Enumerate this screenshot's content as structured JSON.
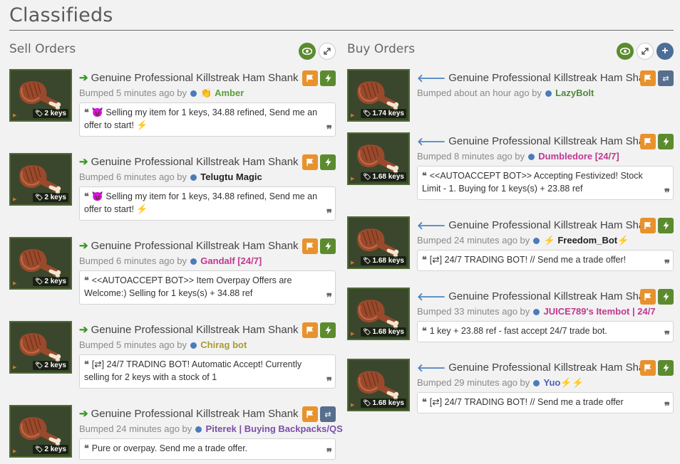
{
  "page": {
    "title": "Classifieds"
  },
  "colors": {
    "sell_arrow": "#3d9a2a",
    "buy_arrow": "#4d84c4",
    "orange_btn": "#e8922e",
    "green_btn": "#5b8b2e",
    "blue_btn": "#576e8c",
    "user_dot": "#4a7cba"
  },
  "sell": {
    "title": "Sell Orders",
    "listings": [
      {
        "item": "Genuine Professional Killstreak Ham Shank",
        "price": "2 keys",
        "bumped": "Bumped 5 minutes ago by",
        "user_prefix_icon": "👏",
        "user": "Amber",
        "user_color": "#5a9e3a",
        "user_suffix_icon": "",
        "message_icon": "😈",
        "message": "Selling my item for 1 keys, 34.88 refined, Send me an offer to start! ",
        "message_suffix": "⚡",
        "action_icon": "lightning"
      },
      {
        "item": "Genuine Professional Killstreak Ham Shank",
        "price": "2 keys",
        "bumped": "Bumped 6 minutes ago by",
        "user_prefix_icon": "",
        "user": "Telugtu Magic",
        "user_color": "#222222",
        "user_suffix_icon": "",
        "message_icon": "😈",
        "message": "Selling my item for 1 keys, 34.88 refined, Send me an offer to start! ",
        "message_suffix": "⚡",
        "action_icon": "lightning"
      },
      {
        "item": "Genuine Professional Killstreak Ham Shank",
        "price": "2 keys",
        "bumped": "Bumped 6 minutes ago by",
        "user_prefix_icon": "",
        "user": "Gandalf [24/7]",
        "user_color": "#c0388f",
        "user_suffix_icon": "",
        "message_icon": "",
        "message": "<<AUTOACCEPT BOT>> Item Overpay Offers are Welcome:) Selling for 1 keys(s) + 34.88 ref",
        "message_suffix": "",
        "action_icon": "lightning"
      },
      {
        "item": "Genuine Professional Killstreak Ham Shank",
        "price": "2 keys",
        "bumped": "Bumped 5 minutes ago by",
        "user_prefix_icon": "",
        "user": "Chirag bot",
        "user_color": "#a89b2f",
        "user_suffix_icon": "",
        "message_icon": "",
        "message": "[⇄] 24/7 TRADING BOT! Automatic Accept! Currently selling for 2 keys with a stock of 1",
        "message_suffix": "",
        "action_icon": "lightning"
      },
      {
        "item": "Genuine Professional Killstreak Ham Shank",
        "price": "2 keys",
        "bumped": "Bumped 24 minutes ago by",
        "user_prefix_icon": "",
        "user": "Piterek | Buying Backpacks/QS",
        "user_color": "#7b4fa8",
        "user_suffix_icon": "",
        "message_icon": "",
        "message": "Pure or overpay. Send me a trade offer.",
        "message_suffix": "",
        "action_icon": "swap"
      }
    ]
  },
  "buy": {
    "title": "Buy Orders",
    "listings": [
      {
        "item": "Genuine Professional Killstreak Ham Shank",
        "price": "1.74 keys",
        "bumped": "Bumped about an hour ago by",
        "user_prefix_icon": "",
        "user": "LazyBolt",
        "user_color": "#4f8a3a",
        "user_suffix_icon": "",
        "message_icon": "",
        "message": "",
        "message_suffix": "",
        "action_icon": "swap"
      },
      {
        "item": "Genuine Professional Killstreak Ham Shank",
        "price": "1.68 keys",
        "bumped": "Bumped 8 minutes ago by",
        "user_prefix_icon": "",
        "user": "Dumbledore [24/7]",
        "user_color": "#c0388f",
        "user_suffix_icon": "",
        "message_icon": "",
        "message": "<<AUTOACCEPT BOT>> Accepting Festivized! Stock Limit - 1. Buying for 1 keys(s) + 23.88 ref",
        "message_suffix": "",
        "action_icon": "lightning"
      },
      {
        "item": "Genuine Professional Killstreak Ham Shank",
        "price": "1.68 keys",
        "bumped": "Bumped 24 minutes ago by",
        "user_prefix_icon": "⚡",
        "user": "Freedom_Bot",
        "user_color": "#222222",
        "user_suffix_icon": "⚡",
        "message_icon": "",
        "message": "[⇄] 24/7 TRADING BOT! // Send me a trade offer!",
        "message_suffix": "",
        "action_icon": "lightning"
      },
      {
        "item": "Genuine Professional Killstreak Ham Shank",
        "price": "1.68 keys",
        "bumped": "Bumped 33 minutes ago by",
        "user_prefix_icon": "",
        "user": "JUICE789's Itembot | 24/7",
        "user_color": "#c0388f",
        "user_suffix_icon": "",
        "message_icon": "",
        "message": "1 key + 23.88 ref - fast accept 24/7 trade bot.",
        "message_suffix": "",
        "action_icon": "lightning"
      },
      {
        "item": "Genuine Professional Killstreak Ham Shank",
        "price": "1.68 keys",
        "bumped": "Bumped 29 minutes ago by",
        "user_prefix_icon": "",
        "user": "Yuo",
        "user_color": "#4d5fb8",
        "user_suffix_icon": "⚡⚡",
        "message_icon": "",
        "message": "[⇄] 24/7 TRADING BOT! // Send me a trade offer",
        "message_suffix": "",
        "action_icon": "lightning"
      }
    ]
  }
}
